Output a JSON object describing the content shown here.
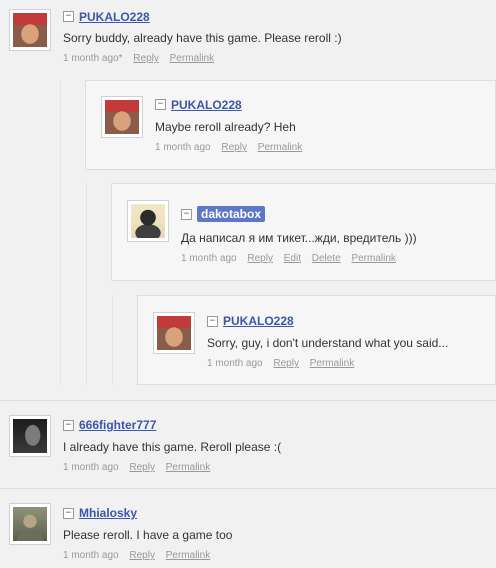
{
  "comments": [
    {
      "username": "PUKALO228",
      "text": "Sorry buddy, already have this game. Please reroll :)",
      "time": "1 month ago*",
      "actions": [
        "Reply",
        "Permalink"
      ],
      "collapse_glyph": "−",
      "avatar_icon": "user-avatar-pukalo"
    },
    {
      "username": "PUKALO228",
      "text": "Maybe reroll already? Heh",
      "time": "1 month ago",
      "actions": [
        "Reply",
        "Permalink"
      ],
      "collapse_glyph": "−",
      "avatar_icon": "user-avatar-pukalo"
    },
    {
      "username": "dakotabox",
      "text": "Да написал я им тикет...жди, вредитель )))",
      "time": "1 month ago",
      "actions": [
        "Reply",
        "Edit",
        "Delete",
        "Permalink"
      ],
      "collapse_glyph": "−",
      "avatar_icon": "user-avatar-dakotabox",
      "is_current_user": true
    },
    {
      "username": "PUKALO228",
      "text": "Sorry, guy, i don't understand what you said...",
      "time": "1 month ago",
      "actions": [
        "Reply",
        "Permalink"
      ],
      "collapse_glyph": "−",
      "avatar_icon": "user-avatar-pukalo"
    },
    {
      "username": "666fighter777",
      "text": "I already have this game. Reroll please :(",
      "time": "1 month ago",
      "actions": [
        "Reply",
        "Permalink"
      ],
      "collapse_glyph": "−",
      "avatar_icon": "user-avatar-666fighter777"
    },
    {
      "username": "Mhialosky",
      "text": "Please reroll. I have a game too",
      "time": "1 month ago",
      "actions": [
        "Reply",
        "Permalink"
      ],
      "collapse_glyph": "−",
      "avatar_icon": "user-avatar-mhialosky"
    }
  ],
  "colors": {
    "username_link": "#3c57a8",
    "current_user_badge": "#5d76c8",
    "meta_text": "#999999",
    "card_background": "#f6f6f6"
  }
}
